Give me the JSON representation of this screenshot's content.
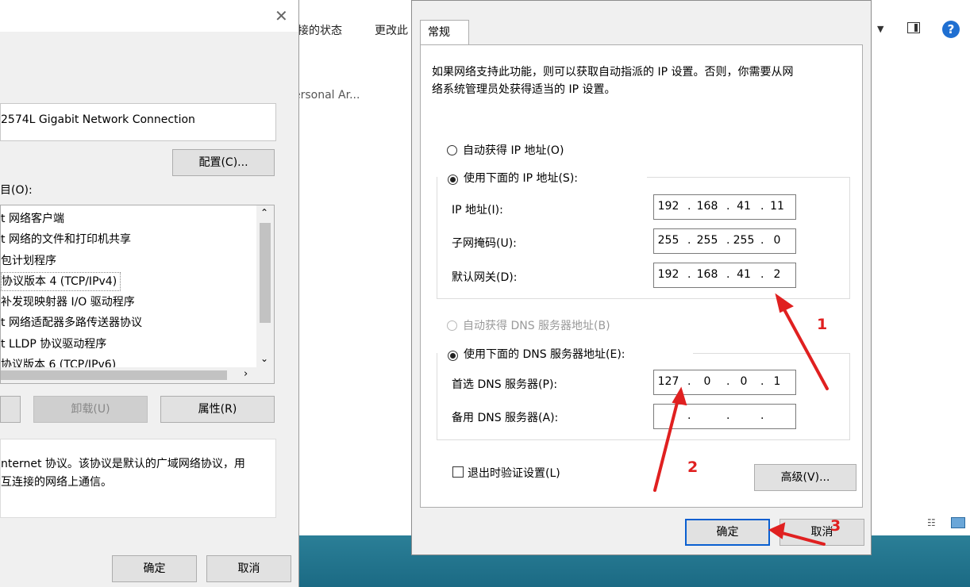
{
  "explorer": {
    "toolbar": {
      "status_label": "接的状态",
      "change_label": "更改此"
    },
    "list_item": "ersonal Ar..."
  },
  "left_dialog": {
    "adapter_name": "2574L Gigabit Network Connection",
    "configure_label": "配置(C)...",
    "items_label": "目(O):",
    "items": [
      "t 网络客户端",
      "t 网络的文件和打印机共享",
      "包计划程序",
      "协议版本 4 (TCP/IPv4)",
      "补发现映射器 I/O 驱动程序",
      "t 网络适配器多路传送器协议",
      "t LLDP 协议驱动程序",
      "协议版本 6 (TCP/IPv6)"
    ],
    "uninstall_label": "卸载(U)",
    "properties_label": "属性(R)",
    "description_line1": "nternet 协议。该协议是默认的广域网络协议，用",
    "description_line2": "互连接的网络上通信。",
    "ok_label": "确定",
    "cancel_label": "取消"
  },
  "main_dialog": {
    "tab_general": "常规",
    "info_line1": "如果网络支持此功能，则可以获取自动指派的 IP 设置。否则，你需要从网",
    "info_line2": "络系统管理员处获得适当的 IP 设置。",
    "auto_ip_label": "自动获得 IP 地址(O)",
    "manual_ip_label": "使用下面的 IP 地址(S):",
    "ip_label": "IP 地址(I):",
    "subnet_label": "子网掩码(U):",
    "gateway_label": "默认网关(D):",
    "ip_address": [
      "192",
      "168",
      "41",
      "11"
    ],
    "subnet_mask": [
      "255",
      "255",
      "255",
      "0"
    ],
    "gateway": [
      "192",
      "168",
      "41",
      "2"
    ],
    "auto_dns_label": "自动获得 DNS 服务器地址(B)",
    "manual_dns_label": "使用下面的 DNS 服务器地址(E):",
    "preferred_dns_label": "首选 DNS 服务器(P):",
    "alternate_dns_label": "备用 DNS 服务器(A):",
    "preferred_dns": [
      "127",
      "0",
      "0",
      "1"
    ],
    "alternate_dns": [
      "",
      "",
      "",
      ""
    ],
    "validate_label": "退出时验证设置(L)",
    "advanced_label": "高级(V)...",
    "ok_label": "确定",
    "cancel_label": "取消"
  },
  "annotations": {
    "n1": "1",
    "n2": "2",
    "n3": "3",
    "color": "#e02020"
  }
}
